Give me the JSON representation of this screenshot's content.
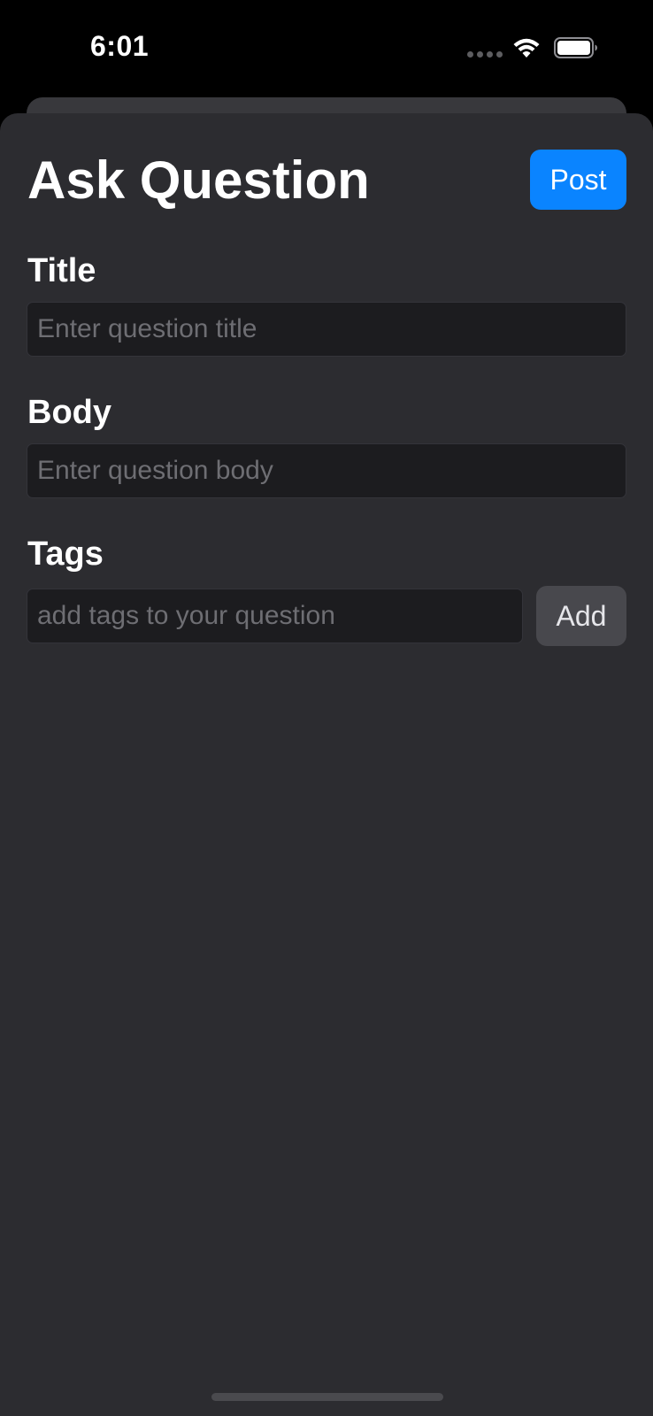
{
  "status_bar": {
    "time": "6:01",
    "icons": [
      "signal-dots-icon",
      "wifi-icon",
      "battery-icon"
    ]
  },
  "header": {
    "title": "Ask Question",
    "post_label": "Post"
  },
  "form": {
    "title_label": "Title",
    "title_value": "",
    "title_placeholder": "Enter question title",
    "body_label": "Body",
    "body_value": "",
    "body_placeholder": "Enter question body",
    "tags_label": "Tags",
    "tags_value": "",
    "tags_placeholder": "add tags to your question",
    "add_label": "Add"
  },
  "colors": {
    "background": "#000000",
    "sheet": "#2c2c30",
    "accent": "#0a84ff",
    "field": "#1c1c1f",
    "secondary_button": "#48484d"
  }
}
